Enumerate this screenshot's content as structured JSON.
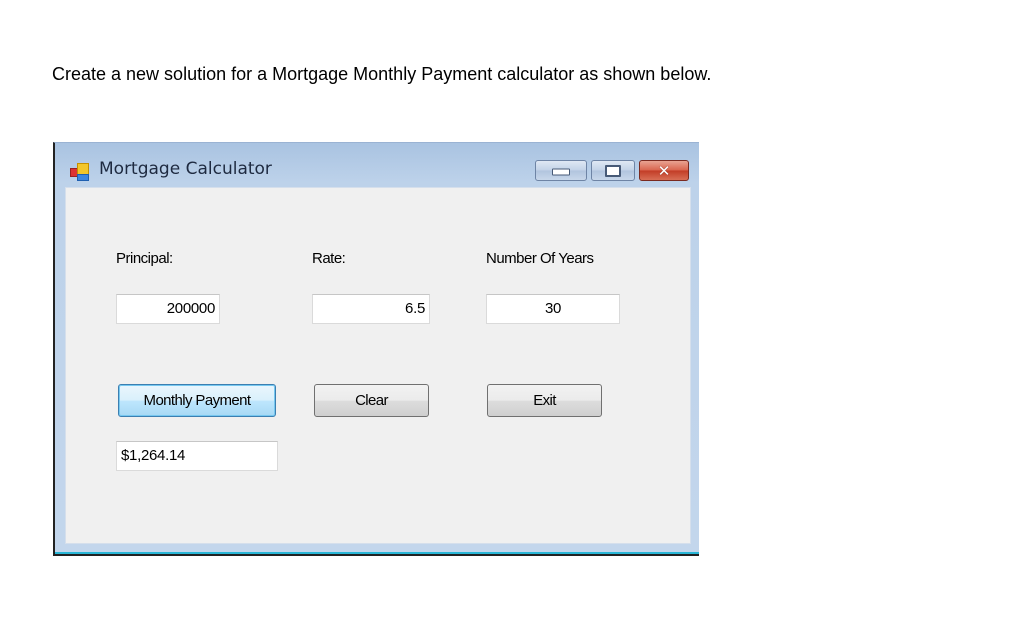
{
  "instruction": "Create a new solution for a Mortgage Monthly Payment calculator as shown below.",
  "window": {
    "title": "Mortgage Calculator",
    "app_icon": "winforms-app-icon",
    "controls": {
      "minimize": "minimize-icon",
      "maximize": "maximize-icon",
      "close_glyph": "✕"
    }
  },
  "form": {
    "principal": {
      "label": "Principal:",
      "value": "200000"
    },
    "rate": {
      "label": "Rate:",
      "value": "6.5"
    },
    "years": {
      "label": "Number Of Years",
      "value": "30"
    },
    "buttons": {
      "monthly_payment": "Monthly Payment",
      "clear": "Clear",
      "exit": "Exit"
    },
    "result": "$1,264.14"
  }
}
